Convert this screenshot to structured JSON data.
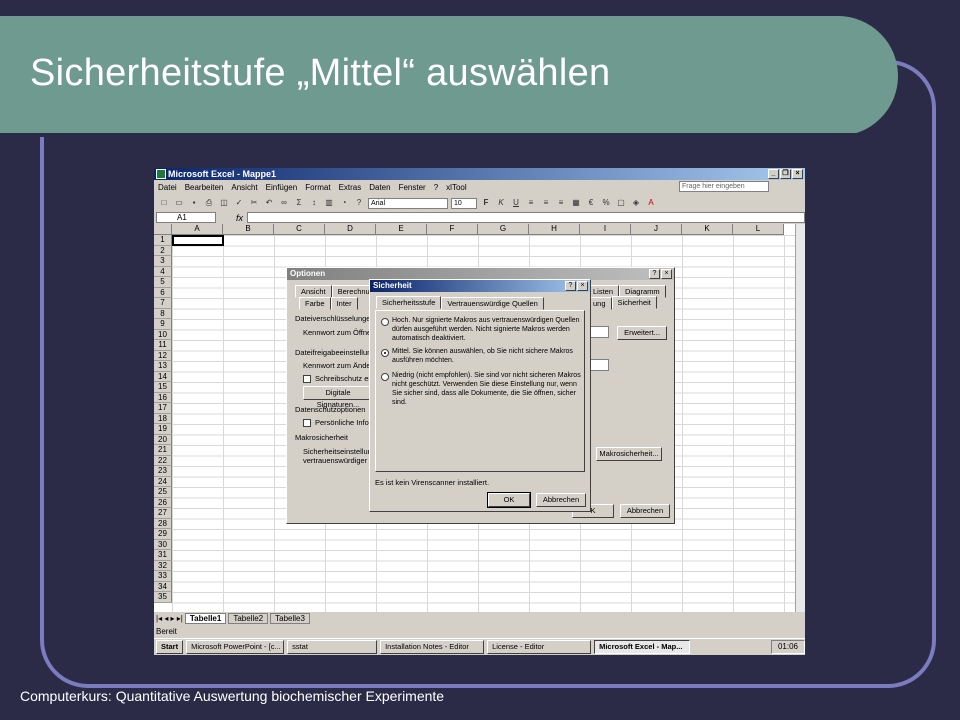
{
  "slide": {
    "title": "Sicherheitstufe „Mittel“ auswählen",
    "footer": "Computerkurs: Quantitative Auswertung biochemischer Experimente"
  },
  "excel": {
    "window_title": "Microsoft Excel - Mappe1",
    "menu": [
      "Datei",
      "Bearbeiten",
      "Ansicht",
      "Einfügen",
      "Format",
      "Extras",
      "Daten",
      "Fenster",
      "?",
      "xlTool"
    ],
    "help_placeholder": "Frage hier eingeben",
    "font_name": "Arial",
    "font_size": "10",
    "name_box": "A1",
    "fx": "fx",
    "columns": [
      "A",
      "B",
      "C",
      "D",
      "E",
      "F",
      "G",
      "H",
      "I",
      "J",
      "K",
      "L"
    ],
    "rows": [
      "1",
      "2",
      "3",
      "4",
      "5",
      "6",
      "7",
      "8",
      "9",
      "10",
      "11",
      "12",
      "13",
      "14",
      "15",
      "16",
      "17",
      "18",
      "19",
      "20",
      "21",
      "22",
      "23",
      "24",
      "25",
      "26",
      "27",
      "28",
      "29",
      "30",
      "31",
      "32",
      "33",
      "34",
      "35"
    ],
    "sheets": [
      "Tabelle1",
      "Tabelle2",
      "Tabelle3"
    ],
    "status": "Bereit"
  },
  "taskbar": {
    "start": "Start",
    "items": [
      "Microsoft PowerPoint - [c...",
      "sstat",
      "Installation Notes - Editor",
      "License - Editor",
      "Microsoft Excel - Map..."
    ],
    "clock": "01:06"
  },
  "optionen": {
    "title": "Optionen",
    "tabs_row1": [
      "Ansicht",
      "Berechnu",
      "Inter",
      "Listen",
      "Diagramm"
    ],
    "tabs_row2": [
      "Farbe",
      "ung",
      "Sicherheit"
    ],
    "label_dateiverschl": "Dateiverschlüsselunge",
    "label_kennwort_oeffnen": "Kennwort zum Öffnen",
    "button_erweitert": "Erweitert...",
    "label_dateifreigabe": "Dateifreigabeeinstellung",
    "label_kennwort_aendern": "Kennwort zum Ändern",
    "label_schreibschutz": "Schreibschutz emp",
    "button_signaturen": "Digitale Signaturen...",
    "label_datenschutz": "Datenschutzoptionen",
    "label_persoenlich": "Persönliche Inform",
    "label_makrosicherheit": "Makrosicherheit",
    "label_sicherheitseinst": "Sicherheitseinstellung",
    "label_vertrauens": "vertrauenswürdiger M",
    "button_makrosicherheit": "Makrosicherheit...",
    "button_ok": "K",
    "button_abbrechen": "Abbrechen"
  },
  "sicherheit": {
    "title": "Sicherheit",
    "tabs": [
      "Sicherheitsstufe",
      "Vertrauenswürdige Quellen"
    ],
    "option_hoch": "Hoch. Nur signierte Makros aus vertrauenswürdigen Quellen dürfen ausgeführt werden. Nicht signierte Makros werden automatisch deaktiviert.",
    "option_mittel": "Mittel. Sie können auswählen, ob Sie nicht sichere Makros ausführen möchten.",
    "option_niedrig": "Niedrig (nicht empfohlen). Sie sind vor nicht sicheren Makros nicht geschützt. Verwenden Sie diese Einstellung nur, wenn Sie sicher sind, dass alle Dokumente, die Sie öffnen, sicher sind.",
    "selected": "mittel",
    "virus_note": "Es ist kein Virenscanner installiert.",
    "button_ok": "OK",
    "button_abbrechen": "Abbrechen"
  }
}
